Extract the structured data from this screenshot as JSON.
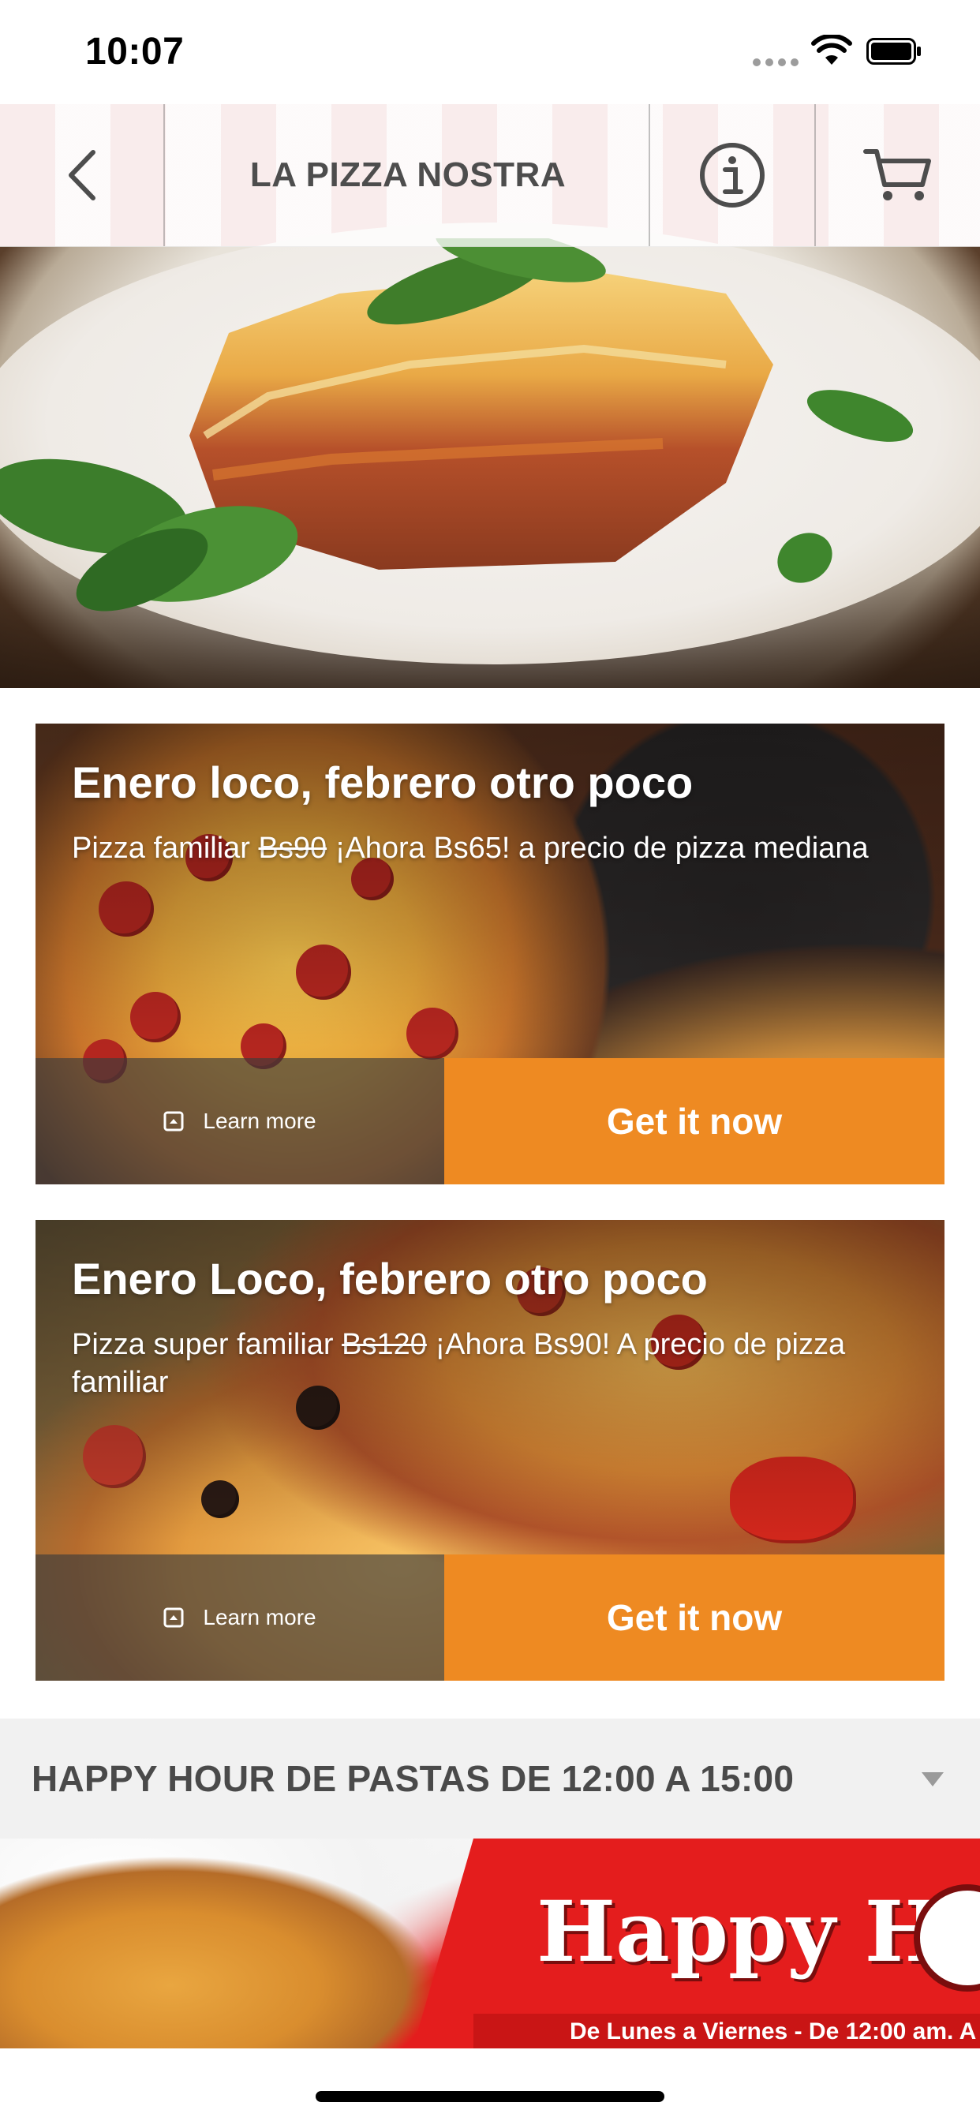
{
  "status_bar": {
    "time": "10:07"
  },
  "nav": {
    "title": "LA PIZZA NOSTRA",
    "back_icon": "chevron-left-icon",
    "info_icon": "info-circle-icon",
    "cart_icon": "cart-icon"
  },
  "promos": [
    {
      "title": "Enero loco, febrero otro poco",
      "desc_prefix": "Pizza familiar",
      "desc_strike": "Bs90",
      "desc_suffix": "¡Ahora Bs65! a precio de pizza mediana",
      "learn_more": "Learn more",
      "cta": "Get it now"
    },
    {
      "title": "Enero Loco, febrero otro poco",
      "desc_prefix": "Pizza super familiar",
      "desc_strike": "Bs120",
      "desc_suffix": "¡Ahora Bs90! A precio de pizza familiar",
      "learn_more": "Learn more",
      "cta": "Get it now"
    }
  ],
  "section": {
    "title": "HAPPY HOUR DE PASTAS DE 12:00 A 15:00"
  },
  "banner": {
    "title": "Happy Ho",
    "subtitle": "De Lunes a Viernes - De 12:00 am. A"
  },
  "colors": {
    "accent": "#ee8a22",
    "banner_red": "#e41d1d"
  }
}
